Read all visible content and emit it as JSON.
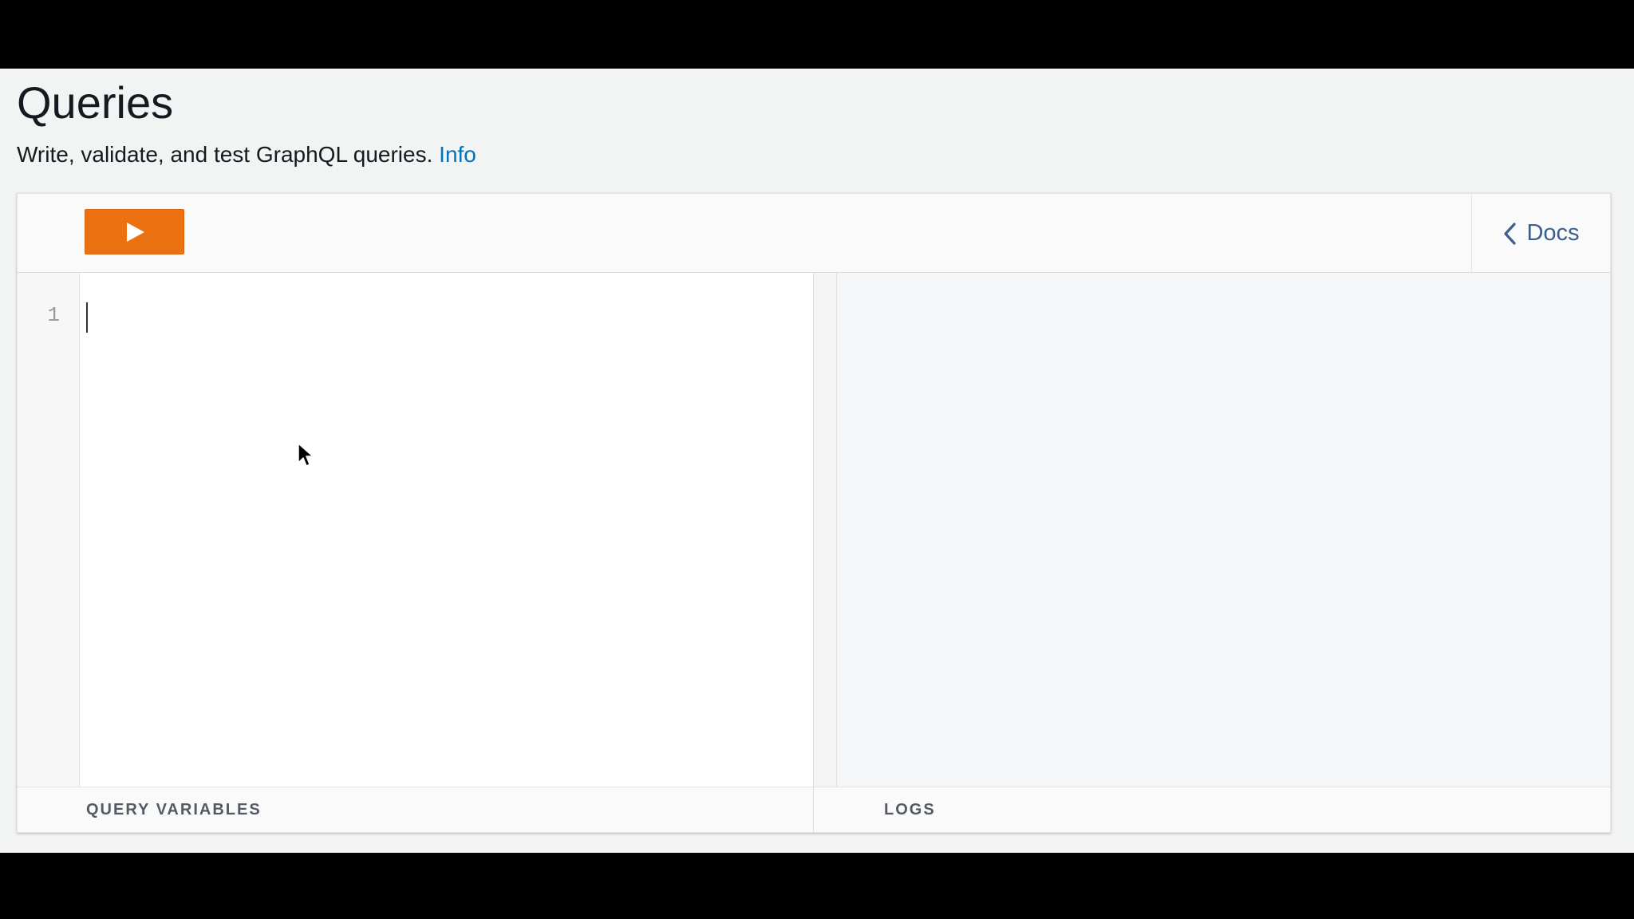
{
  "page": {
    "title": "Queries",
    "description": "Write, validate, and test GraphQL queries.",
    "info_link": "Info"
  },
  "toolbar": {
    "run_button_icon": "play-icon",
    "docs_label": "Docs",
    "docs_icon": "chevron-left-icon"
  },
  "editor": {
    "line_numbers": [
      "1"
    ],
    "content": ""
  },
  "bottom_tabs": {
    "query_variables": "QUERY VARIABLES",
    "logs": "LOGS"
  },
  "colors": {
    "run_button": "#ec7211",
    "link": "#0073bb",
    "docs": "#3b5f8a"
  }
}
